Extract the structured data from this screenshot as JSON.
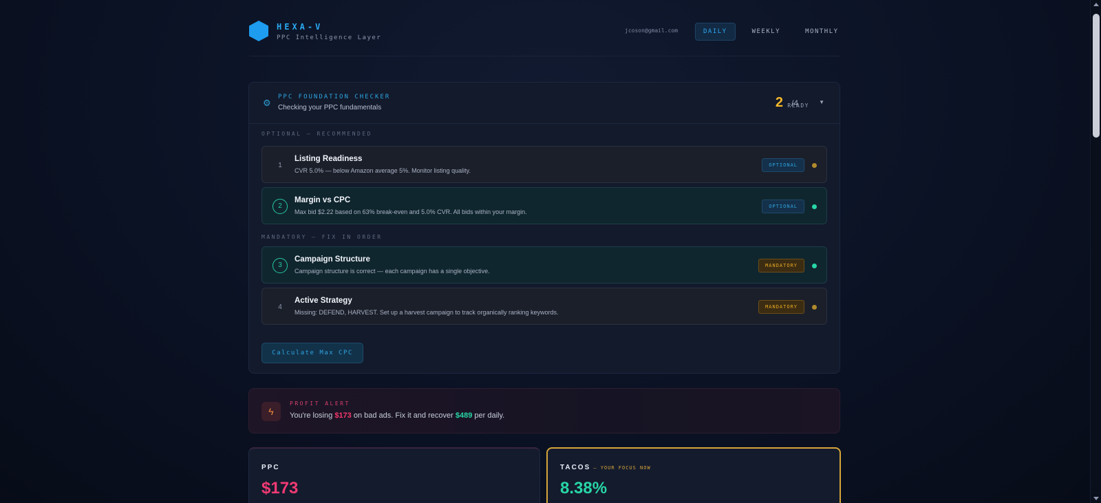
{
  "header": {
    "brand_title": "HEXA-V",
    "brand_subtitle": "PPC Intelligence Layer",
    "user_email": "jcoson@gmail.com",
    "range_tabs": [
      {
        "label": "DAILY",
        "active": true
      },
      {
        "label": "WEEKLY",
        "active": false
      },
      {
        "label": "MONTHLY",
        "active": false
      }
    ]
  },
  "foundation": {
    "title": "PPC FOUNDATION CHECKER",
    "subtitle": "Checking your PPC fundamentals",
    "ready_count": "2",
    "ready_total": "/4",
    "ready_label": "READY",
    "optional_section_label": "OPTIONAL — RECOMMENDED",
    "mandatory_section_label": "MANDATORY — FIX IN ORDER",
    "items": [
      {
        "num": "1",
        "title": "Listing Readiness",
        "desc": "CVR 5.0% — below Amazon average 5%. Monitor listing quality.",
        "badge": "OPTIONAL",
        "status": "pending"
      },
      {
        "num": "2",
        "title": "Margin vs CPC",
        "desc": "Max bid $2.22 based on 63% break-even and 5.0% CVR. All bids within your margin.",
        "badge": "OPTIONAL",
        "status": "ok"
      },
      {
        "num": "3",
        "title": "Campaign Structure",
        "desc": "Campaign structure is correct — each campaign has a single objective.",
        "badge": "MANDATORY",
        "status": "ok"
      },
      {
        "num": "4",
        "title": "Active Strategy",
        "desc": "Missing: DEFEND, HARVEST. Set up a harvest campaign to track organically ranking keywords.",
        "badge": "MANDATORY",
        "status": "pending"
      }
    ],
    "calc_button": "Calculate Max CPC"
  },
  "alert": {
    "label": "PROFIT ALERT",
    "text_prefix": "You're losing",
    "loss_amount": "$173",
    "text_middle": "on bad ads. Fix it and recover",
    "recover_amount": "$489",
    "text_suffix": "per daily."
  },
  "metrics": {
    "ppc": {
      "label": "PPC",
      "value": "$173"
    },
    "tacos": {
      "label": "TACOS",
      "hint": "— YOUR FOCUS NOW",
      "value": "8.38%"
    }
  },
  "colors": {
    "accent_blue": "#2aa8f0",
    "ok_green": "#27d6a6",
    "warn_amber": "#f5b829",
    "loss_pink": "#f23a74"
  }
}
